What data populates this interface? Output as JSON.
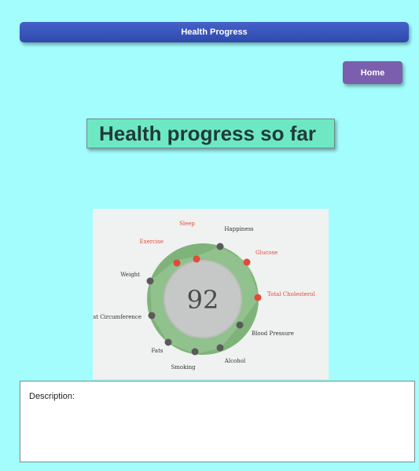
{
  "header": {
    "title": "Health Progress"
  },
  "nav": {
    "home_label": "Home"
  },
  "main": {
    "heading": "Health progress so far"
  },
  "score_chart": {
    "score": "92",
    "colors": {
      "bad": "#e24a3b",
      "neutral": "#5a5a5a",
      "ring": "#7fb37a"
    },
    "factors": [
      {
        "label": "Sleep",
        "status": "bad"
      },
      {
        "label": "Happiness",
        "status": "neutral"
      },
      {
        "label": "Glucose",
        "status": "bad"
      },
      {
        "label": "Total Cholesterol",
        "status": "bad"
      },
      {
        "label": "Blood Pressure",
        "status": "neutral"
      },
      {
        "label": "Alcohol",
        "status": "neutral"
      },
      {
        "label": "Smoking",
        "status": "neutral"
      },
      {
        "label": "Fats",
        "status": "neutral"
      },
      {
        "label": "Waist Circumference",
        "status": "neutral"
      },
      {
        "label": "Weight",
        "status": "neutral"
      },
      {
        "label": "Exercise",
        "status": "bad"
      }
    ]
  },
  "description": {
    "label": "Description:"
  }
}
